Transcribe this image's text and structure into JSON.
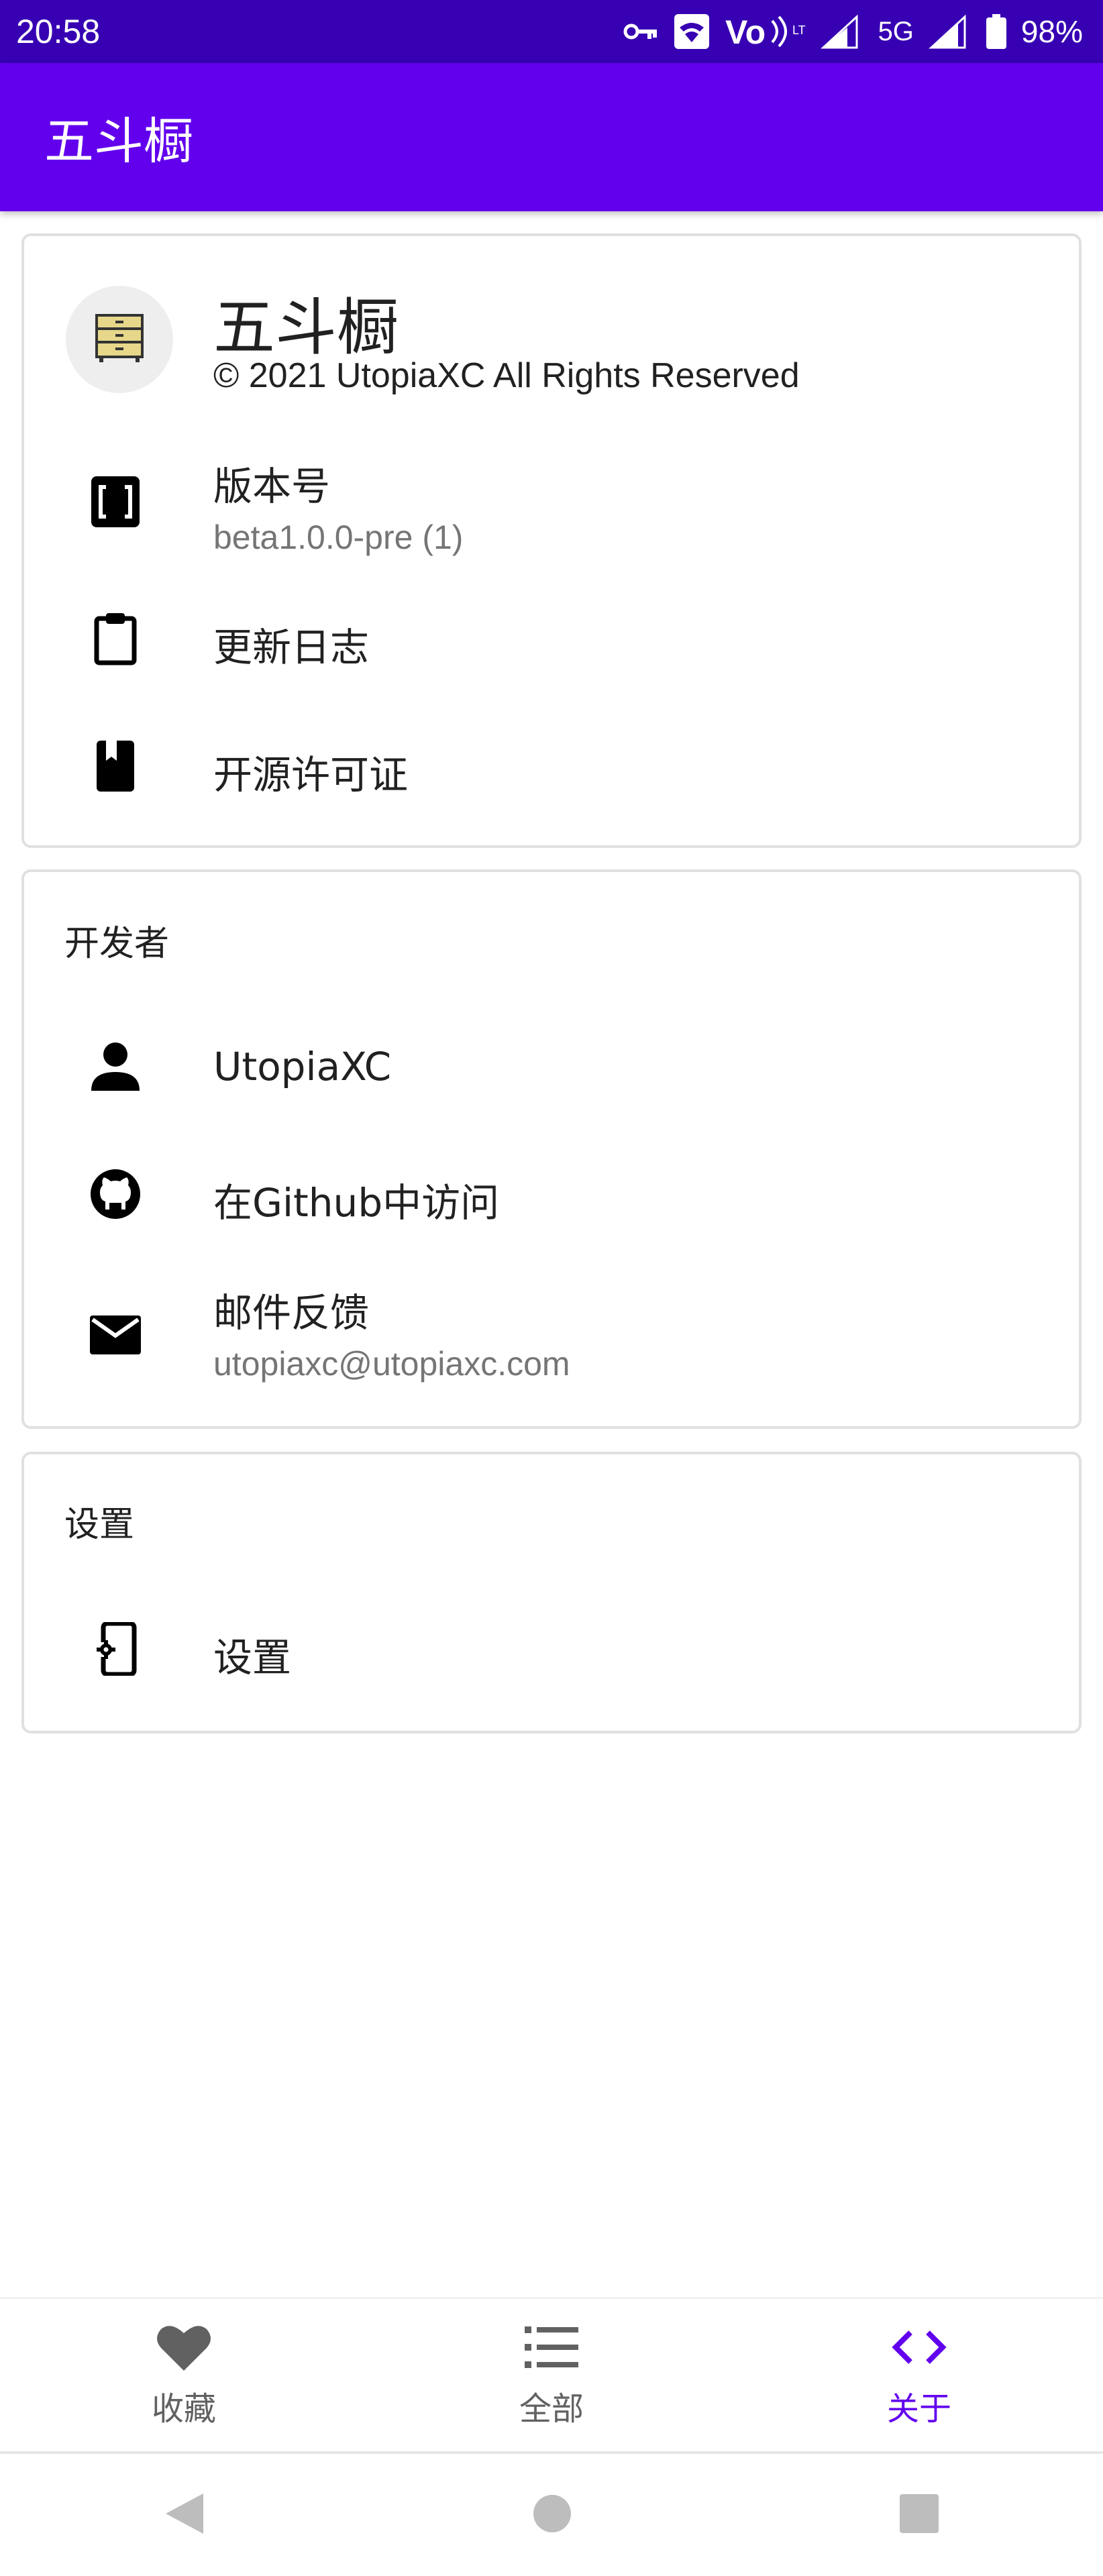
{
  "status_bar": {
    "time": "20:58",
    "battery": "98%",
    "network": "5G"
  },
  "app_bar": {
    "title": "五斗橱"
  },
  "about_card": {
    "app_name": "五斗橱",
    "copyright": "© 2021 UtopiaXC All Rights Reserved",
    "version_label": "版本号",
    "version_value": "beta1.0.0-pre (1)",
    "changelog_label": "更新日志",
    "license_label": "开源许可证"
  },
  "developer_card": {
    "header": "开发者",
    "developer_name": "UtopiaXC",
    "github_label": "在Github中访问",
    "email_label": "邮件反馈",
    "email_value": "utopiaxc@utopiaxc.com"
  },
  "settings_card": {
    "header": "设置",
    "settings_label": "设置"
  },
  "bottom_nav": {
    "items": [
      {
        "label": "收藏",
        "icon": "heart-icon",
        "active": false
      },
      {
        "label": "全部",
        "icon": "list-icon",
        "active": false
      },
      {
        "label": "关于",
        "icon": "code-icon",
        "active": true
      }
    ]
  },
  "colors": {
    "status_bar": "#3700b3",
    "app_bar": "#6200ee",
    "active": "#6200ee",
    "inactive": "#616161"
  }
}
